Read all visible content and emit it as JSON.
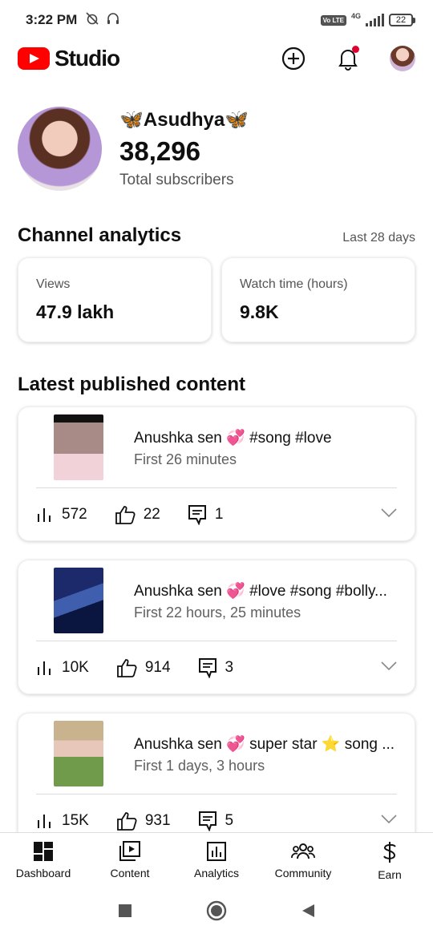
{
  "status_bar": {
    "time": "3:22 PM",
    "icons": [
      "mute-alarm-icon",
      "headphones-icon"
    ],
    "volte": "Vo LTE",
    "network": "4G",
    "battery": "22"
  },
  "app_bar": {
    "logo_text": "Studio",
    "brand_color": "#ff0000",
    "actions": [
      "create-icon",
      "bell-icon",
      "avatar"
    ]
  },
  "channel": {
    "name": "🦋Asudhya🦋",
    "subscriber_count": "38,296",
    "subscriber_label": "Total subscribers"
  },
  "analytics": {
    "title": "Channel analytics",
    "period": "Last 28 days",
    "cards": [
      {
        "label": "Views",
        "value": "47.9 lakh"
      },
      {
        "label": "Watch time (hours)",
        "value": "9.8K"
      }
    ]
  },
  "latest": {
    "title": "Latest published content",
    "items": [
      {
        "title": "Anushka sen 💞 #song #love",
        "subtitle": "First 26 minutes",
        "views": "572",
        "likes": "22",
        "comments": "1"
      },
      {
        "title": "Anushka sen 💞 #love #song #bolly...",
        "subtitle": "First 22 hours, 25 minutes",
        "views": "10K",
        "likes": "914",
        "comments": "3"
      },
      {
        "title": "Anushka sen 💞 super star ⭐ song ...",
        "subtitle": "First 1 days, 3 hours",
        "views": "15K",
        "likes": "931",
        "comments": "5"
      }
    ]
  },
  "bottom_nav": [
    {
      "label": "Dashboard",
      "icon": "dashboard-icon"
    },
    {
      "label": "Content",
      "icon": "content-icon"
    },
    {
      "label": "Analytics",
      "icon": "analytics-icon"
    },
    {
      "label": "Community",
      "icon": "community-icon"
    },
    {
      "label": "Earn",
      "icon": "earn-icon"
    }
  ],
  "system_nav": [
    "recents-icon",
    "home-icon",
    "back-icon"
  ]
}
